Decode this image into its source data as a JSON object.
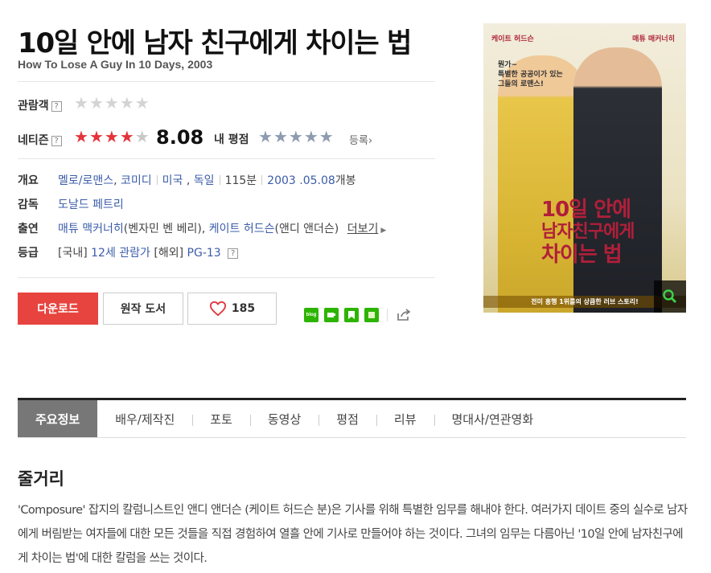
{
  "movie": {
    "title": "10일 안에 남자 친구에게 차이는 법",
    "subtitle": "How To Lose A Guy In 10 Days, 2003"
  },
  "ratings": {
    "audience_label": "관람객",
    "help_mark": "?",
    "netizen_label": "네티즌",
    "netizen_score": "8.08",
    "netizen_stars": 4,
    "my_rating_label": "내 평점",
    "register_link": "등록›"
  },
  "info": {
    "summary_label": "개요",
    "genres": [
      "멜로/로맨스",
      "코미디"
    ],
    "countries": [
      "미국",
      "독일"
    ],
    "runtime": "115분",
    "release_date": "2003 .05.08",
    "release_suffix": "개봉",
    "director_label": "감독",
    "director": "도날드 페트리",
    "cast_label": "출연",
    "cast1": "매튜 맥커너히",
    "cast1_role": "(벤자민 벤 베리)",
    "cast2": "케이트 허드슨",
    "cast2_role": "(앤디 앤더슨)",
    "more_label": "더보기",
    "grade_label": "등급",
    "grade_domestic_tag": "[국내]",
    "grade_domestic": "12세 관람가",
    "grade_overseas_tag": "[해외]",
    "grade_overseas": "PG-13"
  },
  "actions": {
    "download": "다운로드",
    "original_book": "원작 도서",
    "like_count": "185"
  },
  "poster": {
    "tag_left": "케이트 허드슨",
    "tag_right": "매튜 매커너히",
    "quote": "뭔가~\n특별한 공공이가 있는\n그들의 로맨스!",
    "title_lines": [
      "10일 안에",
      "남자친구에게",
      "차이는 법"
    ],
    "footer": "전미 흥행 1위를의 상큼한 러브 스토리!"
  },
  "tabs": [
    "주요정보",
    "배우/제작진",
    "포토",
    "동영상",
    "평점",
    "리뷰",
    "명대사/연관영화"
  ],
  "synopsis": {
    "heading": "줄거리",
    "body": "'Composure' 잡지의 칼럼니스트인 앤디 앤더슨 (케이트 허드슨 분)은 기사를 위해 특별한 임무를 해내야 한다. 여러가지 데이트 중의 실수로 남자에게 버림받는 여자들에 대한 모든 것들을 직접 경험하여 열흘 안에 기사로 만들어야 하는 것이다. 그녀의 임무는 다름아닌 '10일 안에 남자친구에게 차이는 법'에 대한 칼럼을 쓰는 것이다."
  },
  "colors": {
    "accent_red": "#e7443f",
    "star_red": "#e3343b",
    "star_gray": "#c8c8c8",
    "link_blue": "#3b5ca8"
  }
}
